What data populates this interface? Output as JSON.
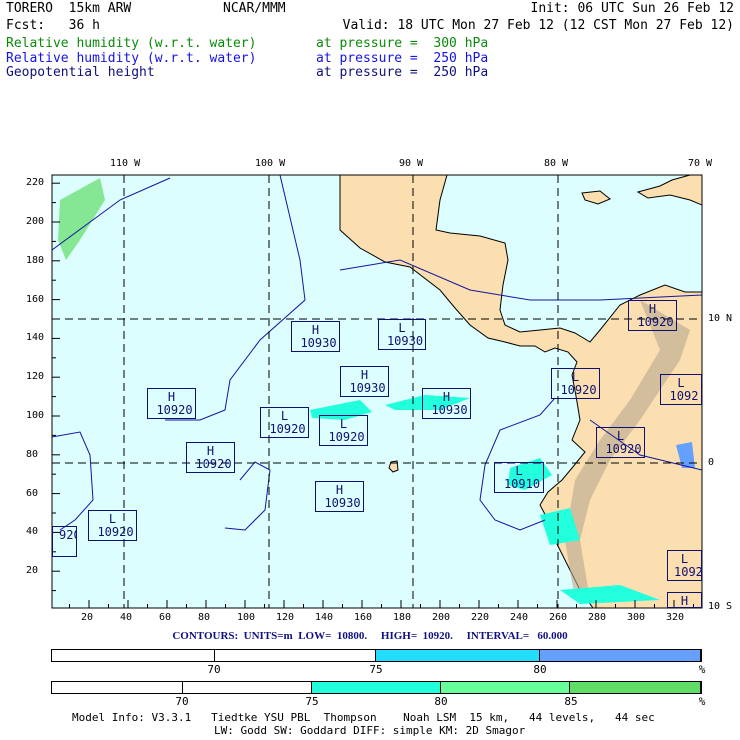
{
  "header": {
    "model": "TORERO  15km ARW",
    "org": "NCAR/MMM",
    "init": "Init: 06 UTC Sun 26 Feb 12",
    "fcst": "Fcst:   36 h",
    "valid": "Valid: 18 UTC Mon 27 Feb 12 (12 CST Mon 27 Feb 12)"
  },
  "fields": [
    {
      "name": "Relative humidity (w.r.t. water)",
      "level": "at pressure =  300 hPa",
      "color": "#0a8a0a"
    },
    {
      "name": "Relative humidity (w.r.t. water)",
      "level": "at pressure =  250 hPa",
      "color": "#1414e6"
    },
    {
      "name": "Geopotential height",
      "level": "at pressure =  250 hPa",
      "color": "#101080"
    }
  ],
  "axes": {
    "top": [
      "110 W",
      "100 W",
      "90 W",
      "80 W",
      "70 W"
    ],
    "right": [
      "10 N",
      "0",
      "10 S"
    ],
    "left": [
      "220",
      "200",
      "180",
      "160",
      "140",
      "120",
      "100",
      "80",
      "60",
      "40",
      "20"
    ],
    "bottom": [
      "20",
      "40",
      "60",
      "80",
      "100",
      "120",
      "140",
      "160",
      "180",
      "200",
      "220",
      "240",
      "260",
      "280",
      "300",
      "320"
    ]
  },
  "pressure_systems": [
    {
      "type": "H",
      "value": "10920"
    },
    {
      "type": "L",
      "value": "10920"
    },
    {
      "type": "",
      "value": "920"
    },
    {
      "type": "H",
      "value": "10930"
    },
    {
      "type": "L",
      "value": "10930"
    },
    {
      "type": "H",
      "value": "10930"
    },
    {
      "type": "L",
      "value": "10920"
    },
    {
      "type": "L",
      "value": "10920"
    },
    {
      "type": "H",
      "value": "10920"
    },
    {
      "type": "H",
      "value": "10930"
    },
    {
      "type": "H",
      "value": "10930"
    },
    {
      "type": "L",
      "value": "10920"
    },
    {
      "type": "L",
      "value": "10920"
    },
    {
      "type": "L",
      "value": "10910"
    },
    {
      "type": "H",
      "value": "10920"
    },
    {
      "type": "L",
      "value": "1092"
    },
    {
      "type": "L",
      "value": "1092"
    },
    {
      "type": "H",
      "value": ""
    }
  ],
  "contours_line": "CONTOURS:  UNITS=m  LOW=  10800.     HIGH=  10920.     INTERVAL=   60.000",
  "colorbars": [
    {
      "colors": [
        "#ffffff",
        "#ffffff",
        "#22ddff",
        "#66a0ff"
      ],
      "labels": [
        "70",
        "75",
        "80",
        "%"
      ]
    },
    {
      "colors": [
        "#ffffff",
        "#ffffff",
        "#22ffdd",
        "#66ff99",
        "#5fdd66"
      ],
      "labels": [
        "70",
        "75",
        "80",
        "85",
        "%"
      ]
    }
  ],
  "footer": {
    "line1": "Model Info: V3.3.1   Tiedtke YSU PBL  Thompson    Noah LSM  15 km,   44 levels,   44 sec",
    "line2": "LW: Godd SW: Goddard DIFF: simple KM: 2D Smagor"
  }
}
